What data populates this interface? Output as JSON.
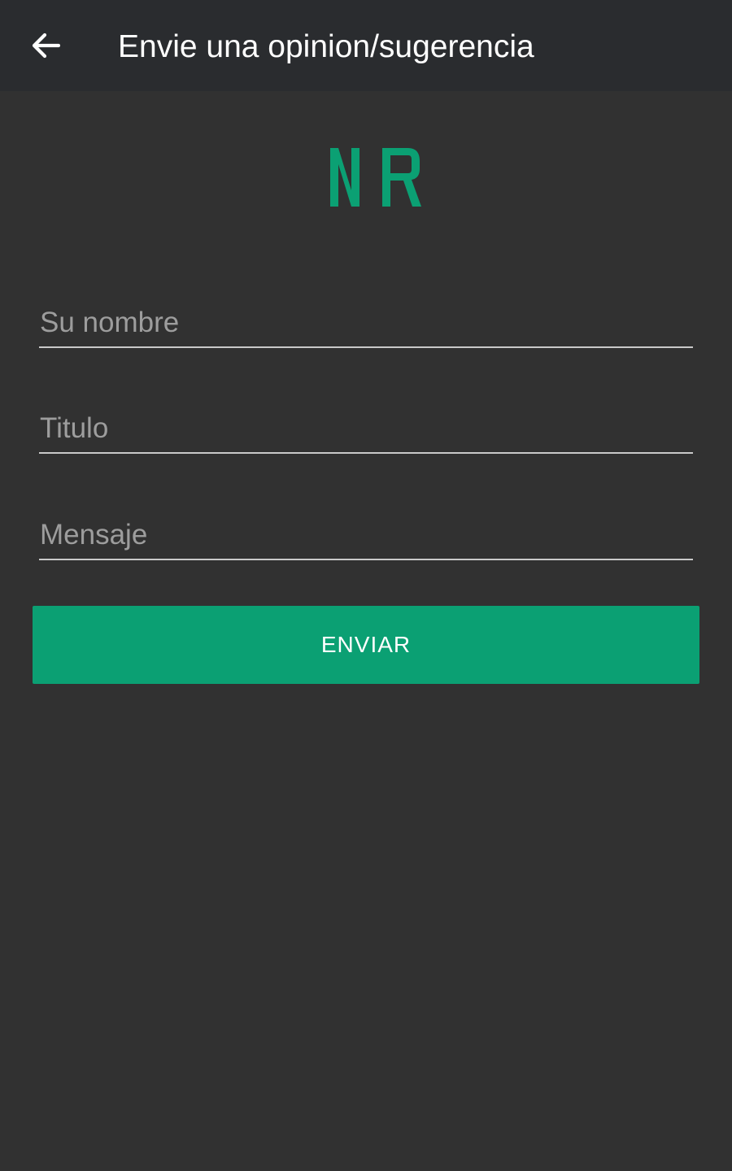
{
  "app_bar": {
    "back_icon": "arrow-left-icon",
    "title": "Envie una opinion/sugerencia"
  },
  "logo": {
    "text": "NR",
    "color": "#0ba073"
  },
  "form": {
    "name_field": {
      "value": "",
      "placeholder": "Su nombre"
    },
    "title_field": {
      "value": "",
      "placeholder": "Titulo"
    },
    "message_field": {
      "value": "",
      "placeholder": "Mensaje"
    },
    "submit_label": "ENVIAR"
  },
  "colors": {
    "background": "#313131",
    "app_bar": "#2a2c2f",
    "accent": "#0ba073",
    "placeholder": "#9d9d9d",
    "underline": "#c9c9c9"
  }
}
